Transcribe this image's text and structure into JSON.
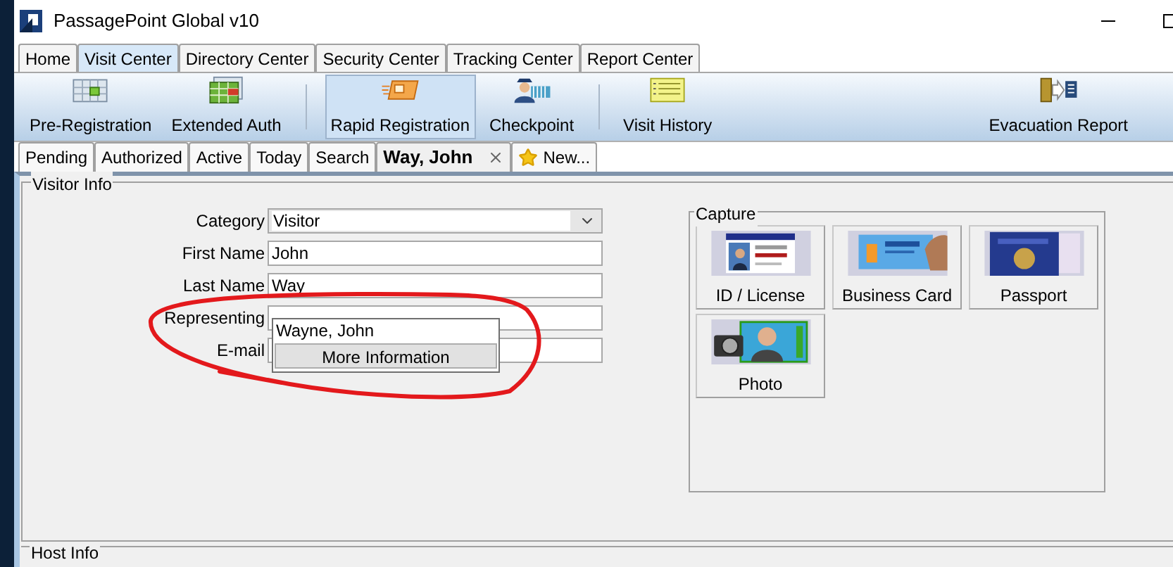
{
  "window": {
    "title": "PassagePoint Global v10"
  },
  "main_tabs": [
    {
      "label": "Home",
      "selected": false
    },
    {
      "label": "Visit Center",
      "selected": true
    },
    {
      "label": "Directory Center",
      "selected": false
    },
    {
      "label": "Security Center",
      "selected": false
    },
    {
      "label": "Tracking Center",
      "selected": false
    },
    {
      "label": "Report Center",
      "selected": false
    }
  ],
  "toolbar": {
    "groups": [
      [
        {
          "label": "Pre-Registration",
          "selected": false
        },
        {
          "label": "Extended Auth",
          "selected": false
        }
      ],
      [
        {
          "label": "Rapid Registration",
          "selected": true
        },
        {
          "label": "Checkpoint",
          "selected": false
        }
      ],
      [
        {
          "label": "Visit History",
          "selected": false
        }
      ]
    ],
    "right": [
      {
        "label": "Evacuation Report",
        "selected": false
      }
    ]
  },
  "sub_tabs": [
    {
      "label": "Pending",
      "selected": false,
      "kind": "plain"
    },
    {
      "label": "Authorized",
      "selected": false,
      "kind": "plain"
    },
    {
      "label": "Active",
      "selected": false,
      "kind": "plain"
    },
    {
      "label": "Today",
      "selected": false,
      "kind": "plain"
    },
    {
      "label": "Search",
      "selected": false,
      "kind": "plain"
    },
    {
      "label": "Way, John",
      "selected": true,
      "kind": "record"
    },
    {
      "label": "New...",
      "selected": false,
      "kind": "new"
    }
  ],
  "visitor_info": {
    "title": "Visitor Info",
    "fields": [
      {
        "label": "Category",
        "kind": "select",
        "value": "Visitor"
      },
      {
        "label": "First Name",
        "kind": "text",
        "value": "John"
      },
      {
        "label": "Last Name",
        "kind": "text",
        "value": "Way"
      },
      {
        "label": "Representing",
        "kind": "text"
      },
      {
        "label": "E-mail",
        "kind": "text"
      }
    ],
    "autocomplete": {
      "suggestion": "Wayne, John",
      "button": "More Information"
    },
    "capture": {
      "title": "Capture",
      "buttons": [
        {
          "label": "ID / License"
        },
        {
          "label": "Business Card"
        },
        {
          "label": "Passport"
        },
        {
          "label": "Photo"
        }
      ]
    }
  },
  "host_info": {
    "title": "Host Info"
  }
}
